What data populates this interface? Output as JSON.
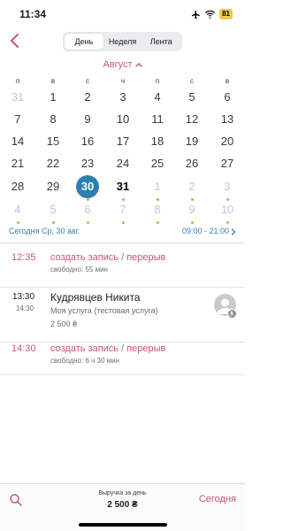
{
  "status": {
    "time": "11:34",
    "battery": "81"
  },
  "nav": {
    "segments": [
      "День",
      "Неделя",
      "Лента"
    ],
    "active_segment": "День"
  },
  "calendar": {
    "month": "Август",
    "weekdays": [
      "п",
      "в",
      "с",
      "ч",
      "п",
      "с",
      "в"
    ],
    "weeks": [
      [
        {
          "d": "31",
          "muted": true
        },
        {
          "d": "1"
        },
        {
          "d": "2"
        },
        {
          "d": "3"
        },
        {
          "d": "4"
        },
        {
          "d": "5"
        },
        {
          "d": "6"
        }
      ],
      [
        {
          "d": "7"
        },
        {
          "d": "8"
        },
        {
          "d": "9"
        },
        {
          "d": "10"
        },
        {
          "d": "11"
        },
        {
          "d": "12"
        },
        {
          "d": "13"
        }
      ],
      [
        {
          "d": "14"
        },
        {
          "d": "15"
        },
        {
          "d": "16"
        },
        {
          "d": "17"
        },
        {
          "d": "18"
        },
        {
          "d": "19"
        },
        {
          "d": "20"
        }
      ],
      [
        {
          "d": "21"
        },
        {
          "d": "22"
        },
        {
          "d": "23"
        },
        {
          "d": "24"
        },
        {
          "d": "25"
        },
        {
          "d": "26"
        },
        {
          "d": "27"
        }
      ],
      [
        {
          "d": "28"
        },
        {
          "d": "29"
        },
        {
          "d": "30",
          "selected": true,
          "dot": true
        },
        {
          "d": "31",
          "today": true,
          "dot": true
        },
        {
          "d": "1",
          "muted": true,
          "dot": true
        },
        {
          "d": "2",
          "muted": true,
          "dot": true
        },
        {
          "d": "3",
          "muted": true,
          "dot": true
        }
      ],
      [
        {
          "d": "4",
          "muted": true,
          "dot": true
        },
        {
          "d": "5",
          "muted": true,
          "dot": true
        },
        {
          "d": "6",
          "muted": true,
          "dot": true
        },
        {
          "d": "7",
          "muted": true,
          "dot": true
        },
        {
          "d": "8",
          "muted": true,
          "dot": true
        },
        {
          "d": "9",
          "muted": true,
          "dot": true
        },
        {
          "d": "10",
          "muted": true,
          "dot": true
        }
      ]
    ],
    "dot_color": "#e0a24a",
    "selected_color": "#2d7fb0"
  },
  "today_row": {
    "label": "Сегодня Ср, 30 авг.",
    "hours": "09:00 - 21:00"
  },
  "schedule": {
    "free1": {
      "time": "12:35",
      "title": "создать запись / перерыв",
      "sub": "свободно: 55 мин"
    },
    "appointment": {
      "start": "13:30",
      "end": "14:30",
      "name": "Кудрявцев Никита",
      "service": "Моя услуга (тестовая услуга)",
      "price": "2 500 ₴"
    },
    "free2": {
      "time": "14:30",
      "title": "создать запись / перерыв",
      "sub": "свободно: 6 ч 30 мин"
    }
  },
  "bottom": {
    "revenue_label": "Выручка за день",
    "revenue_value": "2 500 ₴",
    "today_button": "Сегодня"
  },
  "colors": {
    "accent": "#c8557a",
    "link": "#3a7fb0"
  }
}
